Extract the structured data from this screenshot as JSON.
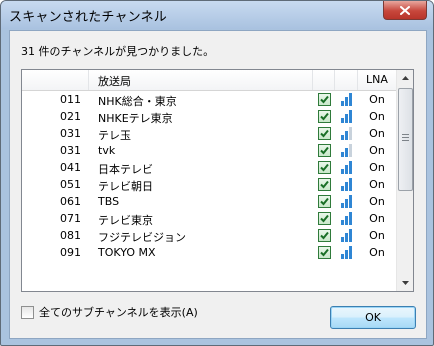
{
  "window": {
    "title": "スキャンされたチャンネル"
  },
  "message": "31 件のチャンネルが見つかりました。",
  "list": {
    "columns": {
      "name": "放送局",
      "lna": "LNA"
    },
    "rows": [
      {
        "num": "011",
        "name": "NHK総合・東京",
        "checked": true,
        "signal_level": 3,
        "lna": "On"
      },
      {
        "num": "021",
        "name": "NHKEテレ東京",
        "checked": true,
        "signal_level": 3,
        "lna": "On"
      },
      {
        "num": "031",
        "name": "テレ玉",
        "checked": true,
        "signal_level": 2,
        "lna": "On"
      },
      {
        "num": "031",
        "name": "tvk",
        "checked": true,
        "signal_level": 2,
        "lna": "On"
      },
      {
        "num": "041",
        "name": "日本テレビ",
        "checked": true,
        "signal_level": 3,
        "lna": "On"
      },
      {
        "num": "051",
        "name": "テレビ朝日",
        "checked": true,
        "signal_level": 3,
        "lna": "On"
      },
      {
        "num": "061",
        "name": "TBS",
        "checked": true,
        "signal_level": 3,
        "lna": "On"
      },
      {
        "num": "071",
        "name": "テレビ東京",
        "checked": true,
        "signal_level": 3,
        "lna": "On"
      },
      {
        "num": "081",
        "name": "フジテレビジョン",
        "checked": true,
        "signal_level": 3,
        "lna": "On"
      },
      {
        "num": "091",
        "name": "TOKYO MX",
        "checked": true,
        "signal_level": 3,
        "lna": "On"
      }
    ]
  },
  "show_all_subchannels": {
    "label": "全てのサブチャンネルを表示(A)",
    "checked": false
  },
  "ok_button": {
    "label": "OK"
  },
  "colors": {
    "check": "#1a6f27",
    "signal_on": "#2f86d4",
    "signal_off": "#c8d2dc"
  },
  "icons": {
    "close": "close-icon",
    "scroll_up": "chevron-up-icon",
    "scroll_down": "chevron-down-icon",
    "signal": "signal-strength-icon",
    "checkmark": "checkmark-icon"
  }
}
